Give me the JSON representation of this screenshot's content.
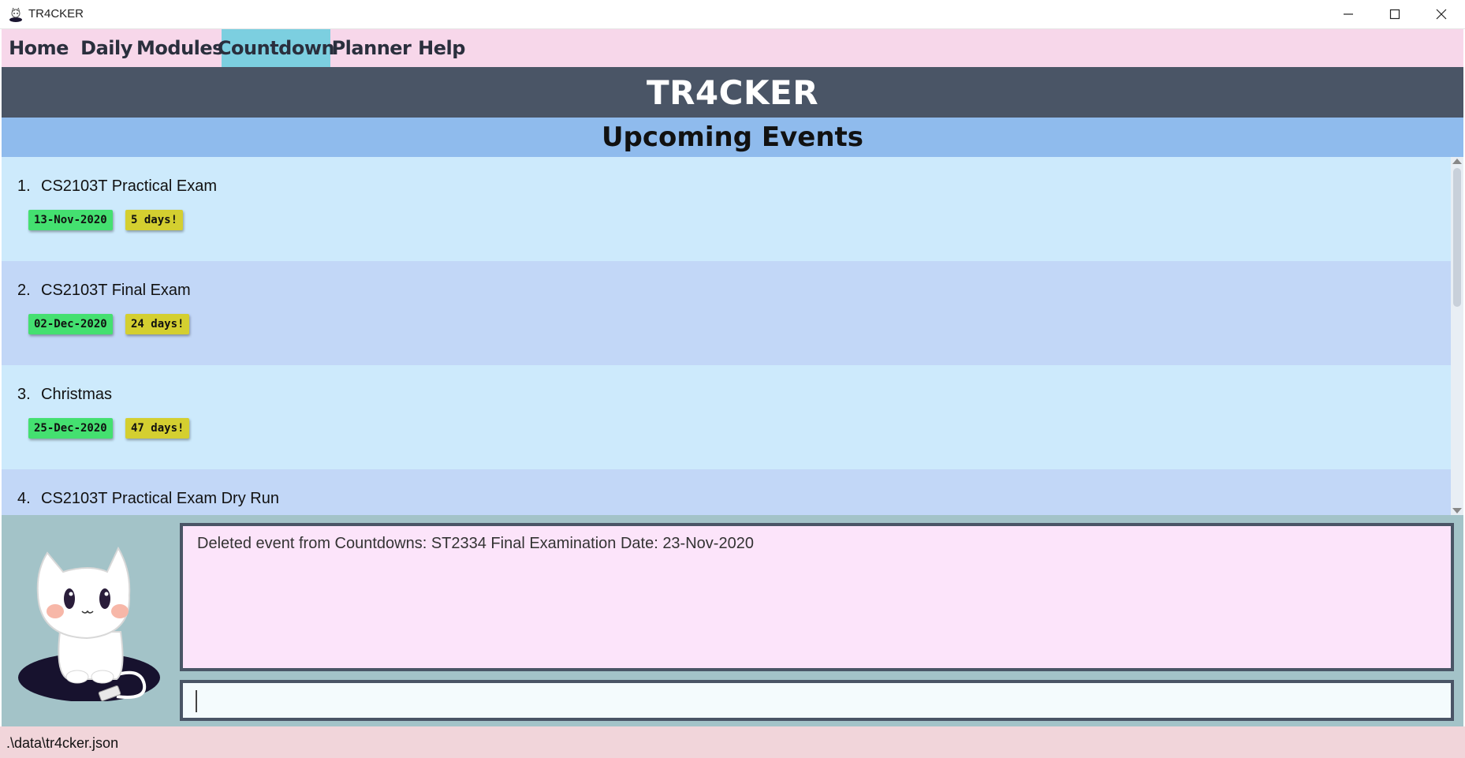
{
  "window": {
    "title": "TR4CKER"
  },
  "menu": {
    "items": [
      {
        "label": "Home",
        "active": false
      },
      {
        "label": "Daily",
        "active": false
      },
      {
        "label": "Modules",
        "active": false
      },
      {
        "label": "Countdown",
        "active": true
      },
      {
        "label": "Planner",
        "active": false
      },
      {
        "label": "Help",
        "active": false
      }
    ]
  },
  "header": {
    "title": "TR4CKER",
    "subtitle": "Upcoming Events"
  },
  "events": [
    {
      "number": "1.",
      "name": "CS2103T Practical Exam",
      "date": "13-Nov-2020",
      "countdown": "5 days!"
    },
    {
      "number": "2.",
      "name": "CS2103T Final Exam",
      "date": "02-Dec-2020",
      "countdown": "24 days!"
    },
    {
      "number": "3.",
      "name": "Christmas",
      "date": "25-Dec-2020",
      "countdown": "47 days!"
    },
    {
      "number": "4.",
      "name": "CS2103T Practical Exam Dry Run"
    }
  ],
  "result": {
    "text": "Deleted event from Countdowns: ST2334 Final Examination Date: 23-Nov-2020"
  },
  "command": {
    "value": "",
    "placeholder": ""
  },
  "status": {
    "path": ".\\data\\tr4cker.json"
  },
  "colors": {
    "menubar": "#f7d7ea",
    "active_tab": "#7ccfe0",
    "banner": "#4a5566",
    "subbanner": "#8fbbed",
    "card_odd": "#cdeafc",
    "card_even": "#c2d7f7",
    "tag_date": "#44e070",
    "tag_days": "#d4cf30",
    "result_bg": "#fce4fa",
    "status_bg": "#f1d5da"
  }
}
